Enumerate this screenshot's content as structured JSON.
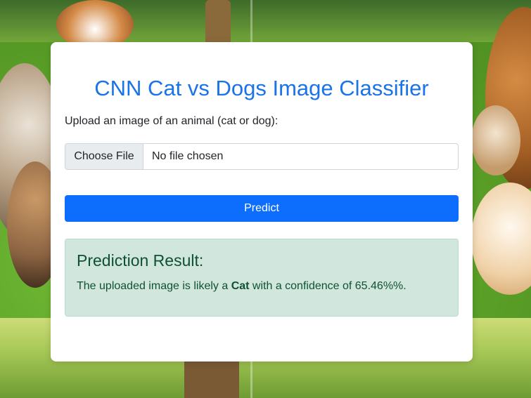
{
  "page": {
    "title": "CNN Cat vs Dogs Image Classifier",
    "upload_label": "Upload an image of an animal (cat or dog):",
    "file_button": "Choose File",
    "file_status": "No file chosen",
    "predict_button": "Predict"
  },
  "result": {
    "heading": "Prediction Result:",
    "text_prefix": "The uploaded image is likely a ",
    "label": "Cat",
    "text_middle": " with a confidence of ",
    "confidence": "65.46%%."
  },
  "colors": {
    "title": "#1a73e8",
    "button": "#0d6efd",
    "result_bg": "#d1e7dd",
    "result_text": "#0f5132"
  }
}
